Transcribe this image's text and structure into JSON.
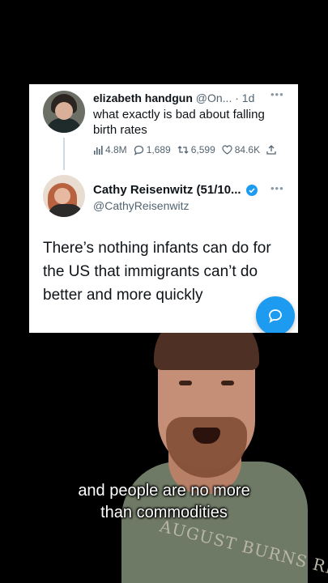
{
  "tweet_reply": {
    "author_name": "elizabeth handgun",
    "handle_truncated": "@On...",
    "time": "· 1d",
    "text": "what exactly is bad about falling birth rates",
    "stats": {
      "views": "4.8M",
      "replies": "1,689",
      "retweets": "6,599",
      "likes": "84.6K"
    }
  },
  "tweet_quote": {
    "author_name": "Cathy Reisenwitz (51/10...",
    "handle": "@CathyReisenwitz",
    "text": "There’s nothing infants can do for the US that immigrants can’t do better and more quickly"
  },
  "caption": {
    "line1": "and people are no more",
    "line2": "than commodities"
  },
  "shirt_print": "AUGUST BURNS RED",
  "colors": {
    "accent": "#1d9bf0",
    "text": "#0f1419",
    "secondary_text": "#536471"
  }
}
